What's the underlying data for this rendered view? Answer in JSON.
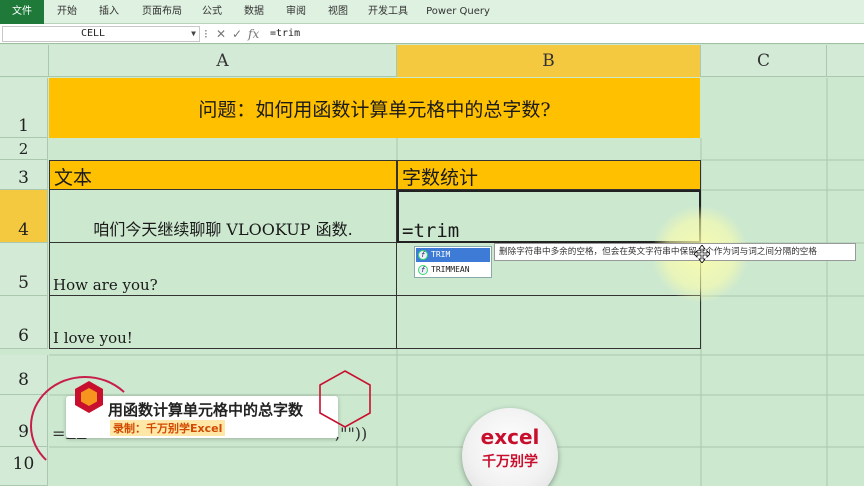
{
  "ribbon": {
    "tabs": [
      "文件",
      "开始",
      "插入",
      "页面布局",
      "公式",
      "数据",
      "审阅",
      "视图",
      "开发工具",
      "Power Query"
    ]
  },
  "formula_bar": {
    "name_box": "CELL",
    "formula": "=trim"
  },
  "columns": [
    "A",
    "B",
    "C"
  ],
  "rows": [
    "1",
    "2",
    "3",
    "4",
    "5",
    "6",
    "8",
    "9",
    "10"
  ],
  "sheet": {
    "title": "问题：如何用函数计算单元格中的总字数?",
    "header_a": "文本",
    "header_b": "字数统计",
    "a4": "咱们今天继续聊聊  VLOOKUP 函数.",
    "b4": "=trim",
    "a5": "How are you?",
    "a6": "I love you!",
    "a9_start": "=LE",
    "a9_end": ",\"\"))"
  },
  "autocomplete": {
    "items": [
      "TRIM",
      "TRIMMEAN"
    ],
    "tooltip": "删除字符串中多余的空格，但会在英文字符串中保留一个作为词与词之间分隔的空格"
  },
  "overlay": {
    "title": "用函数计算单元格中的总字数",
    "subtitle": "录制：千万别学Excel"
  },
  "watermark": {
    "line1": "excel",
    "line2": "千万别学"
  },
  "colors": {
    "header_fill": "#ffc000",
    "sheet_bg": "#cce8cf",
    "selected_header": "#f5c93f",
    "file_tab": "#1f7a3a"
  }
}
